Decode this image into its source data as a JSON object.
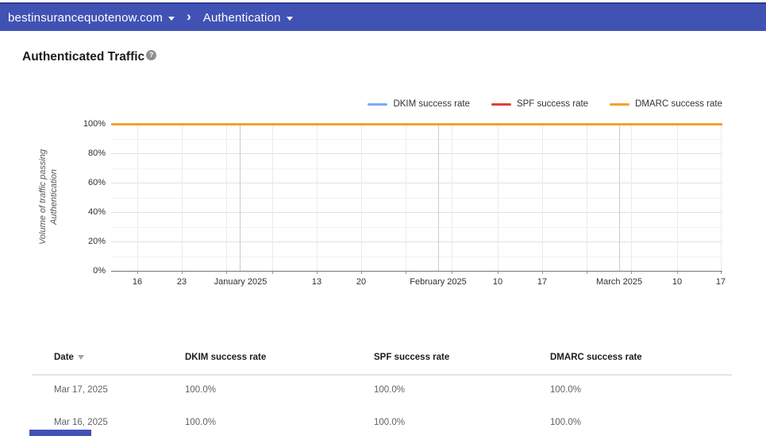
{
  "header": {
    "site": "bestinsurancequotenow.com",
    "separator": "›",
    "section": "Authentication"
  },
  "page": {
    "title": "Authenticated Traffic",
    "help_icon": "?"
  },
  "chart_data": {
    "type": "line",
    "title": "Authenticated Traffic",
    "ylabel": "Volume of traffic passing Authentication",
    "ylabel_lines": [
      "Volume of traffic passing",
      "Authentication"
    ],
    "ylim": [
      0,
      100
    ],
    "grid": true,
    "legend_position": "top-right",
    "y_ticks": [
      {
        "label": "100%",
        "value": 100
      },
      {
        "label": "80%",
        "value": 80
      },
      {
        "label": "60%",
        "value": 60
      },
      {
        "label": "40%",
        "value": 40
      },
      {
        "label": "20%",
        "value": 20
      },
      {
        "label": "0%",
        "value": 0
      }
    ],
    "x_ticks": [
      {
        "label": "16",
        "f": 0.0429,
        "month": false
      },
      {
        "label": "23",
        "f": 0.1156,
        "month": false
      },
      {
        "label": "January 2025",
        "f": 0.2117,
        "month": true
      },
      {
        "label": "13",
        "f": 0.3364,
        "month": false
      },
      {
        "label": "20",
        "f": 0.4091,
        "month": false
      },
      {
        "label": "February 2025",
        "f": 0.5351,
        "month": true
      },
      {
        "label": "10",
        "f": 0.6325,
        "month": false
      },
      {
        "label": "17",
        "f": 0.7052,
        "month": false
      },
      {
        "label": "March 2025",
        "f": 0.8312,
        "month": true
      },
      {
        "label": "10",
        "f": 0.926,
        "month": false
      },
      {
        "label": "17",
        "f": 0.9974,
        "month": false
      }
    ],
    "weekly_gridlines_f": [
      0.0429,
      0.1156,
      0.1883,
      0.2636,
      0.3364,
      0.4091,
      0.4818,
      0.5571,
      0.6325,
      0.7052,
      0.7779,
      0.8506,
      0.926,
      0.9974
    ],
    "month_gridlines_f": [
      0.2104,
      0.5351,
      0.8312
    ],
    "x_range_visible": [
      "Dec 16, 2024",
      "Mar 17, 2025"
    ],
    "series": [
      {
        "name": "DKIM success rate",
        "color": "#7BAAF7",
        "constant_value_pct": 100.0
      },
      {
        "name": "SPF success rate",
        "color": "#DB4437",
        "constant_value_pct": 100.0
      },
      {
        "name": "DMARC success rate",
        "color": "#F0A32E",
        "constant_value_pct": 100.0
      }
    ]
  },
  "table": {
    "columns": [
      "Date",
      "DKIM success rate",
      "SPF success rate",
      "DMARC success rate"
    ],
    "sorted_column": "Date",
    "rows": [
      [
        "Mar 17, 2025",
        "100.0%",
        "100.0%",
        "100.0%"
      ],
      [
        "Mar 16, 2025",
        "100.0%",
        "100.0%",
        "100.0%"
      ]
    ]
  },
  "colors": {
    "topbar": "#4053B5",
    "grid_major": "#e2e2e2",
    "grid_minor": "#f3f3f3",
    "grid_week": "#ebebeb",
    "grid_month": "#cbcbcb",
    "axis_baseline": "#757575"
  }
}
